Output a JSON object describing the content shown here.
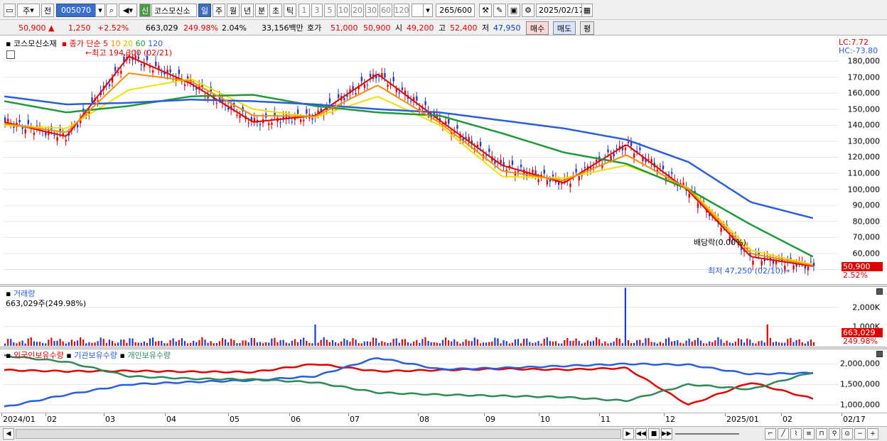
{
  "toolbar": {
    "type_label": "주",
    "prev_label": "전",
    "code": "005070",
    "badge": "신",
    "stock_name": "코스모신소",
    "periods": [
      "일",
      "주",
      "월",
      "년",
      "분",
      "초",
      "틱"
    ],
    "selected_period": "일",
    "intervals": [
      "1",
      "3",
      "5",
      "10",
      "20",
      "30",
      "60",
      "120"
    ],
    "count": "265",
    "count_total": "/600",
    "date": "2025/02/17"
  },
  "info": {
    "price": "50,900",
    "change": "1,250",
    "change_pct": "+2.52%",
    "volume": "663,029",
    "volume_pct": "249.98%",
    "turnover_pct": "2.04%",
    "amount": "33,156백만",
    "quote_label": "호가",
    "ask": "51,000",
    "bid": "50,900",
    "open_label": "시",
    "open": "49,200",
    "high_label": "고",
    "high": "52,400",
    "low_label": "저",
    "low": "47,950",
    "buy_label": "매수",
    "sell_label": "매도",
    "avg_label": "평"
  },
  "price_panel": {
    "legend_name": "코스모신소재",
    "legend_ma": "종가 단순",
    "ma_periods": [
      "5",
      "10",
      "20",
      "60",
      "120"
    ],
    "ma_colors": [
      "#e00000",
      "#ff8c00",
      "#f0e000",
      "#1f9a3a",
      "#2a5ee0"
    ],
    "lc": "LC:7.72",
    "hc": "HC:-73.80",
    "high_annotation": "최고 194,300 (02/21)",
    "low_annotation": "최저 47,250 (02/10)",
    "dividend_annotation": "배당락(0.00%)",
    "current_price_tag": "50,900",
    "current_pct_tag": "2.52%"
  },
  "volume_panel": {
    "title": "거래량",
    "current": "663,029주(249.98%)",
    "tag_value": "663,029",
    "tag_pct": "249.98%"
  },
  "holdings_panel": {
    "legend": [
      "외국인보유수량",
      "기관보유수량",
      "개인보유수량"
    ],
    "colors": [
      "#e00000",
      "#2a5ee0",
      "#2e8b57"
    ]
  },
  "x_labels": [
    "2024/01",
    "02",
    "03",
    "04",
    "05",
    "06",
    "07",
    "08",
    "09",
    "10",
    "11",
    "12",
    "2025/01",
    "02",
    "02/17"
  ],
  "chart_data": [
    {
      "type": "line",
      "title": "코스모신소재",
      "y_ticks": [
        50000,
        60000,
        70000,
        80000,
        90000,
        100000,
        110000,
        120000,
        130000,
        140000,
        150000,
        160000,
        170000,
        180000
      ],
      "y_tick_labels": [
        "",
        "60,000",
        "70,000",
        "80,000",
        "90,000",
        "100,000",
        "110,000",
        "120,000",
        "130,000",
        "140,000",
        "150,000",
        "160,000",
        "170,000",
        "180,000"
      ],
      "ylim": [
        44000,
        192000
      ],
      "x": [
        "2024/01",
        "02",
        "03",
        "04",
        "05",
        "06",
        "07",
        "08",
        "09",
        "10",
        "11",
        "12",
        "2025/01",
        "02"
      ],
      "series": [
        {
          "name": "5",
          "values": [
            142000,
            133000,
            183000,
            166000,
            142000,
            146000,
            172000,
            143000,
            115000,
            104000,
            128000,
            99000,
            58000,
            52000
          ]
        },
        {
          "name": "20",
          "values": [
            140000,
            138000,
            162000,
            169000,
            150000,
            145000,
            158000,
            140000,
            108000,
            107000,
            115000,
            101000,
            62000,
            53000
          ]
        },
        {
          "name": "60",
          "values": [
            155000,
            148000,
            152000,
            158000,
            159000,
            152000,
            148000,
            146000,
            135000,
            123000,
            116000,
            100000,
            78000,
            58000
          ]
        },
        {
          "name": "120",
          "values": [
            158000,
            153000,
            154000,
            156000,
            155000,
            153000,
            150000,
            148000,
            143000,
            138000,
            131000,
            117000,
            92000,
            82000
          ]
        }
      ]
    },
    {
      "type": "bar",
      "title": "거래량",
      "y_tick_labels": [
        "1,000K",
        "2,000K"
      ],
      "ylim": [
        0,
        2900000
      ],
      "spikes": [
        {
          "x": "11",
          "value": 3000000
        },
        {
          "x": "2025/01",
          "value": 1100000
        },
        {
          "x": "06",
          "value": 1100000
        }
      ]
    },
    {
      "type": "line",
      "title": "보유수량",
      "y_tick_labels": [
        "1,000,000",
        "1,500,000",
        "2,000,000"
      ],
      "x": [
        "2024/01",
        "02",
        "03",
        "04",
        "05",
        "06",
        "07",
        "08",
        "09",
        "10",
        "11",
        "12",
        "2025/01",
        "02"
      ],
      "series": [
        {
          "name": "외국인보유수량",
          "values": [
            1850000,
            1820000,
            1830000,
            1810000,
            1800000,
            2000000,
            1820000,
            1850000,
            1880000,
            1860000,
            1900000,
            1000000,
            1550000,
            1150000
          ]
        },
        {
          "name": "기관보유수량",
          "values": [
            950000,
            1250000,
            1500000,
            1560000,
            1600000,
            1700000,
            2150000,
            1870000,
            1900000,
            1950000,
            2000000,
            1980000,
            1750000,
            1780000
          ]
        },
        {
          "name": "개인보유수량",
          "values": [
            2200000,
            2050000,
            1700000,
            1640000,
            1620000,
            1550000,
            1300000,
            1250000,
            1220000,
            1190000,
            1100000,
            1500000,
            1380000,
            1800000
          ]
        }
      ]
    }
  ]
}
